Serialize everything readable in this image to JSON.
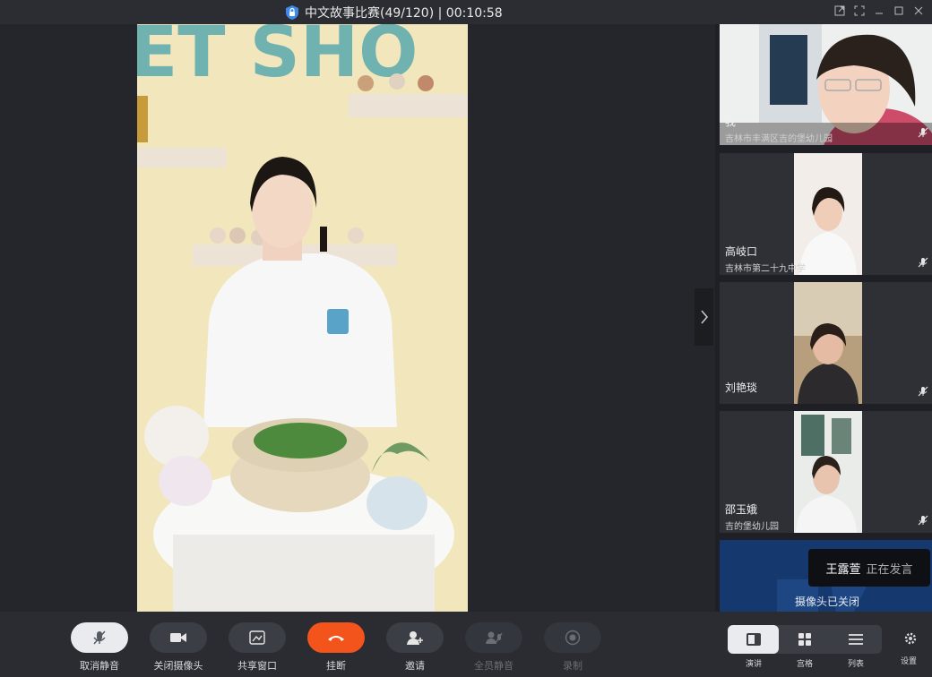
{
  "window": {
    "title": "中文故事比赛(49/120) | 00:10:58"
  },
  "main_video": {
    "sign_text": "ET SHO"
  },
  "participants": [
    {
      "name": "我",
      "org": "吉林市丰满区吉的堡幼儿园"
    },
    {
      "name": "高岐口",
      "org": "吉林市第二十九中学"
    },
    {
      "name": "刘艳琰",
      "org": ""
    },
    {
      "name": "邵玉娥",
      "org": "吉的堡幼儿园"
    }
  ],
  "camera_off_tile": {
    "label": "摄像头已关闭"
  },
  "speaker_toast": {
    "name": "王露萱",
    "status": "正在发言"
  },
  "toolbar": {
    "unmute": "取消静音",
    "camera_off": "关闭摄像头",
    "share": "共享窗口",
    "hangup": "挂断",
    "invite": "邀请",
    "mute_all": "全员静音",
    "record": "录制"
  },
  "layout": {
    "speaker": "演讲",
    "grid": "宫格",
    "list": "列表"
  },
  "settings_label": "设置",
  "colors": {
    "accent_red": "#f2541c",
    "lock_blue": "#3d8be8"
  }
}
